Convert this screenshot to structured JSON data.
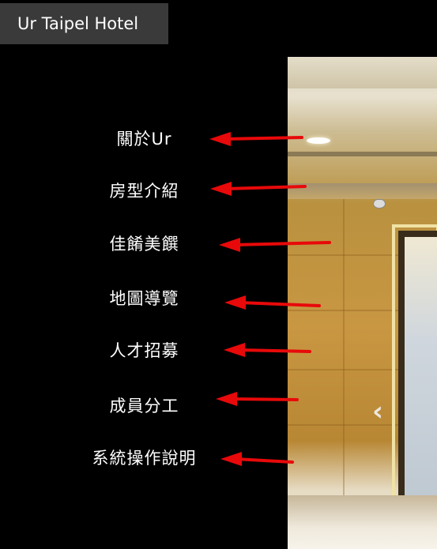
{
  "brand": {
    "title": "Ur Taipel Hotel"
  },
  "menu": {
    "items": [
      {
        "label": "關於Ur"
      },
      {
        "label": "房型介紹"
      },
      {
        "label": "佳餚美饌"
      },
      {
        "label": "地圖導覽"
      },
      {
        "label": "人才招募"
      },
      {
        "label": "成員分工"
      },
      {
        "label": "系統操作說明"
      }
    ]
  },
  "carousel": {
    "prev_icon": "chevron-left-icon",
    "prev_glyph": "‹"
  },
  "annotations": {
    "arrow_color": "#e8090a",
    "arrow_icon": "red-arrow-left-icon"
  },
  "colors": {
    "background": "#000000",
    "brand_bar": "#3a3a3a",
    "menu_text": "#ffffff"
  }
}
